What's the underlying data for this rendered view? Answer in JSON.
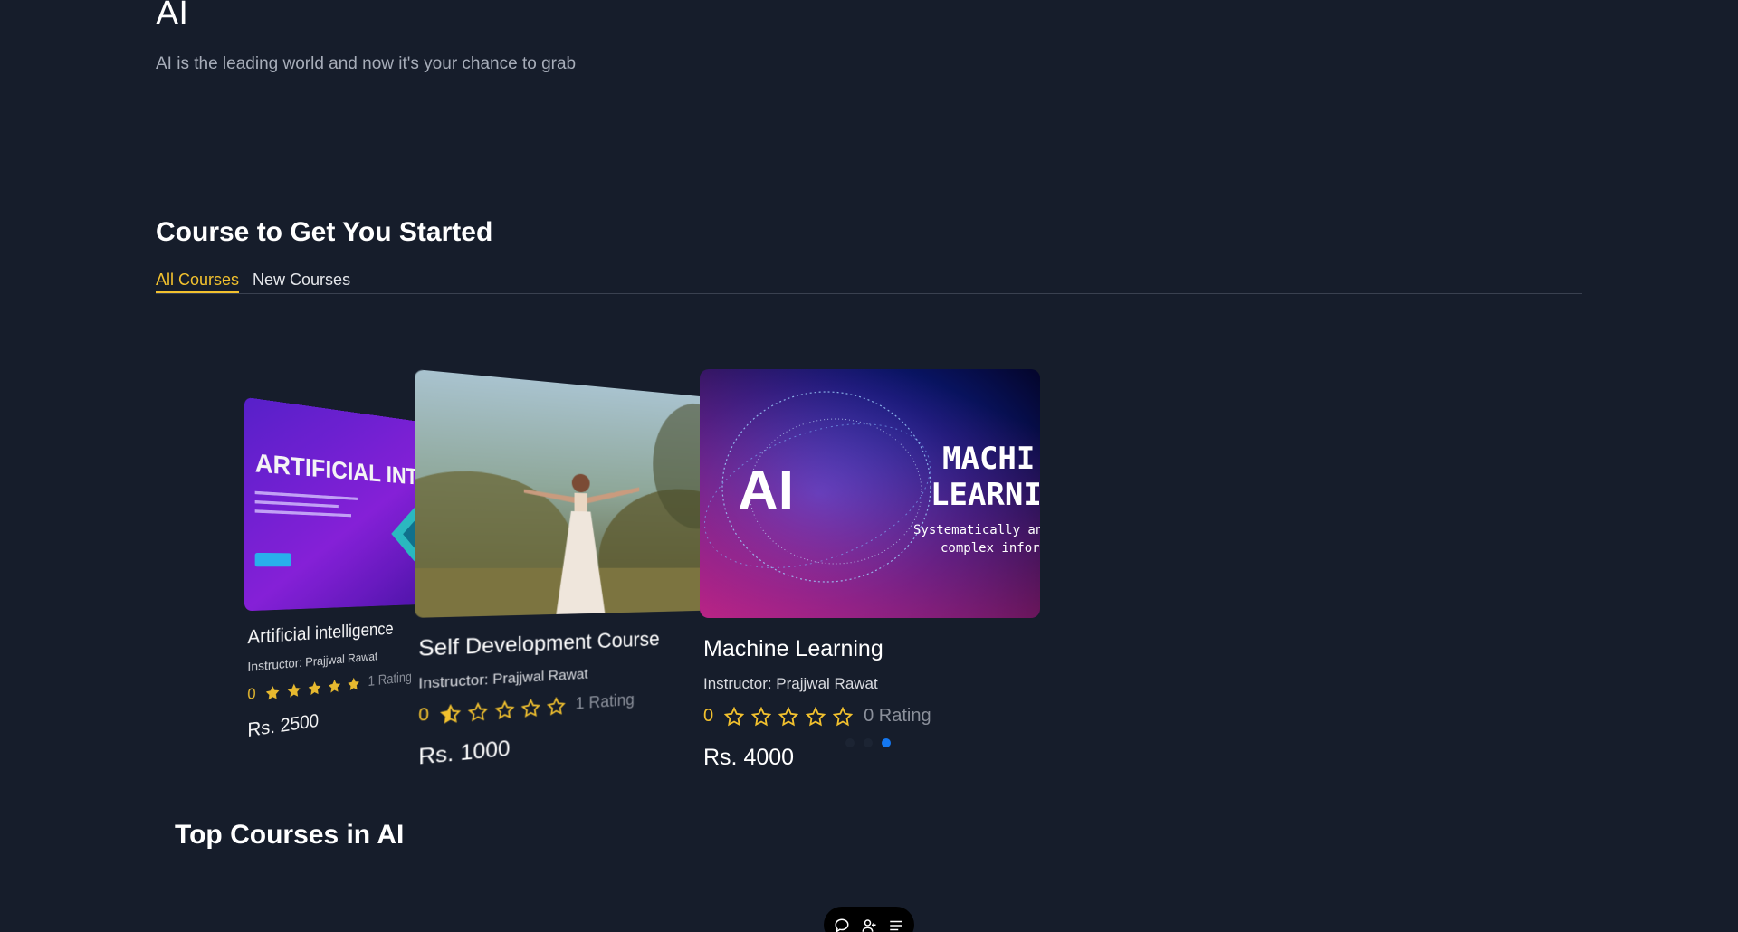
{
  "hero": {
    "title": "AI",
    "subtitle": "AI is the leading world and now it's your chance to grab"
  },
  "courses_section": {
    "title": "Course to Get You Started",
    "tabs": [
      {
        "label": "All Courses",
        "active": true
      },
      {
        "label": "New Courses",
        "active": false
      }
    ]
  },
  "cards": [
    {
      "title": "Artificial intelligence",
      "instructor": "Instructor: Prajjwal Rawat",
      "rating_value": "0",
      "rating_count": "1 Rating",
      "price": "Rs. 2500",
      "thumb_text": "ARTIFICIAL INTELLIGENCE"
    },
    {
      "title": "Self Development Course",
      "instructor": "Instructor: Prajjwal Rawat",
      "rating_value": "0",
      "rating_count": "1 Rating",
      "price": "Rs. 1000"
    },
    {
      "title": "Machine Learning",
      "instructor": "Instructor: Prajjwal Rawat",
      "rating_value": "0",
      "rating_count": "0 Rating",
      "price": "Rs. 4000",
      "thumb_ai": "AI",
      "thumb_line1": "MACHI",
      "thumb_line2": "LEARNIN",
      "thumb_sub1": "Systematically analy",
      "thumb_sub2": "complex informa"
    }
  ],
  "carousel": {
    "dot_count": 3,
    "active_dot": 2
  },
  "top_section": {
    "title": "Top Courses in AI"
  },
  "bottom_bar": {
    "icons": [
      "chat-icon",
      "add-user-icon",
      "menu-list-icon"
    ]
  },
  "colors": {
    "background": "#161d2b",
    "accent": "#f2c12e",
    "active_dot": "#1477f0"
  }
}
